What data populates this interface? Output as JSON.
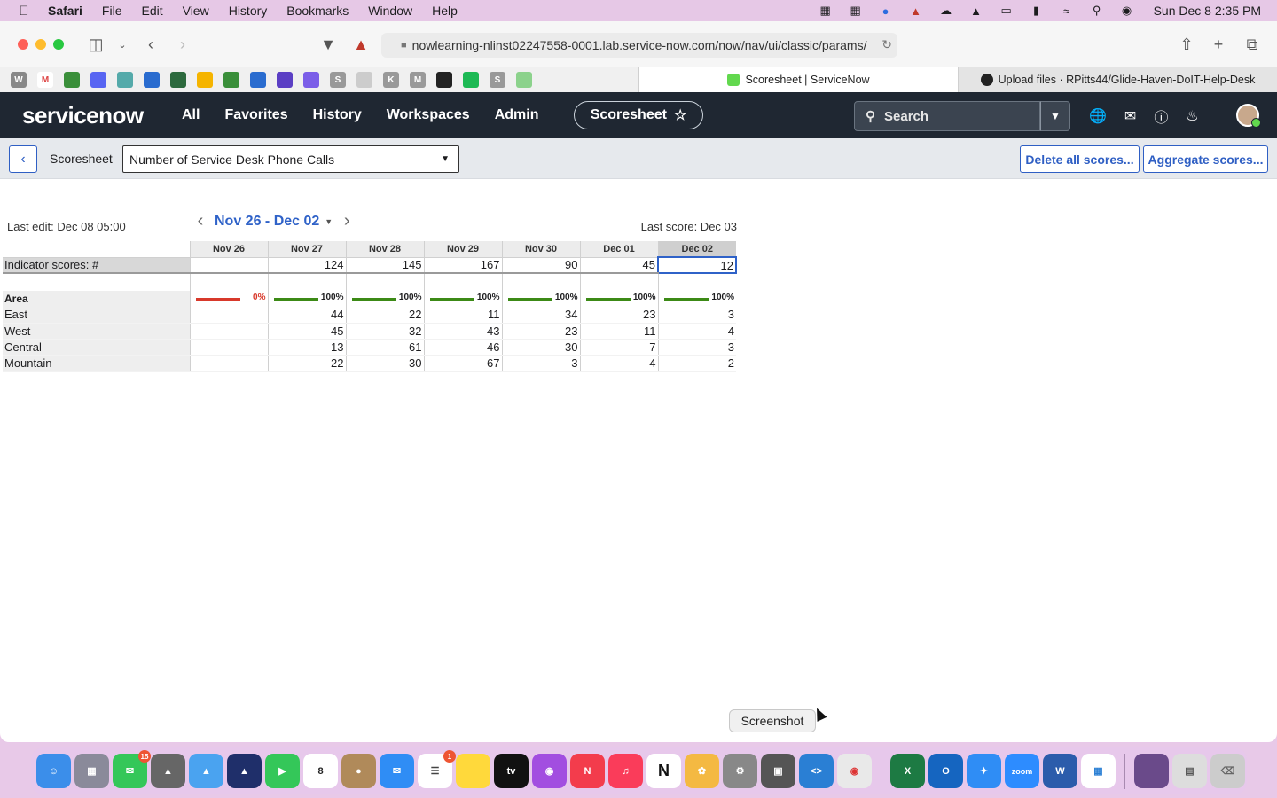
{
  "menubar": {
    "app": "Safari",
    "items": [
      "File",
      "Edit",
      "View",
      "History",
      "Bookmarks",
      "Window",
      "Help"
    ],
    "clock": "Sun Dec 8  2:35 PM"
  },
  "browser": {
    "url": "nowlearning-nlinst02247558-0001.lab.service-now.com/now/nav/ui/classic/params/",
    "tabs": [
      {
        "title": "Scoresheet | ServiceNow"
      },
      {
        "title": "Upload files · RPitts44/Glide-Haven-DoIT-Help-Desk"
      }
    ]
  },
  "sn_header": {
    "logo": "servicenow",
    "nav": [
      "All",
      "Favorites",
      "History",
      "Workspaces",
      "Admin"
    ],
    "context_pill": "Scoresheet",
    "search_label": "Search"
  },
  "subbar": {
    "title": "Scoresheet",
    "indicator": "Number of Service Desk Phone Calls",
    "delete_btn": "Delete all scores...",
    "aggregate_btn": "Aggregate scores..."
  },
  "sheet": {
    "last_edit": "Last edit: Dec 08 05:00",
    "period": "Nov 26 - Dec 02",
    "last_score": "Last score: Dec 03",
    "days": [
      "Nov 26",
      "Nov 27",
      "Nov 28",
      "Nov 29",
      "Nov 30",
      "Dec 01",
      "Dec 02"
    ],
    "indicator_label": "Indicator scores: #",
    "indicator_scores": [
      "",
      "124",
      "145",
      "167",
      "90",
      "45",
      "12"
    ],
    "breakdown_label": "Area",
    "completeness": [
      {
        "pct": "0%",
        "value": 0
      },
      {
        "pct": "100%",
        "value": 100
      },
      {
        "pct": "100%",
        "value": 100
      },
      {
        "pct": "100%",
        "value": 100
      },
      {
        "pct": "100%",
        "value": 100
      },
      {
        "pct": "100%",
        "value": 100
      },
      {
        "pct": "100%",
        "value": 100
      }
    ],
    "rows": [
      {
        "label": "East",
        "values": [
          "",
          "44",
          "22",
          "11",
          "34",
          "23",
          "3"
        ]
      },
      {
        "label": "West",
        "values": [
          "",
          "45",
          "32",
          "43",
          "23",
          "11",
          "4"
        ]
      },
      {
        "label": "Central",
        "values": [
          "",
          "13",
          "61",
          "46",
          "30",
          "7",
          "3"
        ]
      },
      {
        "label": "Mountain",
        "values": [
          "",
          "22",
          "30",
          "67",
          "3",
          "4",
          "2"
        ]
      }
    ]
  },
  "tooltip": "Screenshot",
  "colors": {
    "sn_header": "#1f2732",
    "link_blue": "#2f62c8",
    "bar_ok": "#3c8a16",
    "bar_bad": "#d8392b"
  }
}
